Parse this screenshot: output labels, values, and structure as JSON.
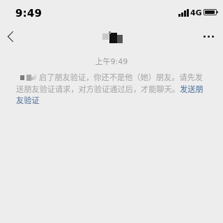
{
  "status_bar": {
    "time": "9:49",
    "network": "4G",
    "signal_icon": "signal-bars-icon",
    "battery_icon": "battery-icon"
  },
  "nav": {
    "back_icon": "chevron-left-icon",
    "more_icon": "more-dots-icon"
  },
  "chat": {
    "timestamp": "上午9:49",
    "system_message_text": "启了朋友验证，你还不是他（她）朋友。请先发送朋友验证请求，对方验证通过后，才能聊天。",
    "system_message_link": "发送朋友验证"
  },
  "colors": {
    "background": "#ededed",
    "link": "#4a6c97",
    "system_text": "#a3a3a3"
  }
}
